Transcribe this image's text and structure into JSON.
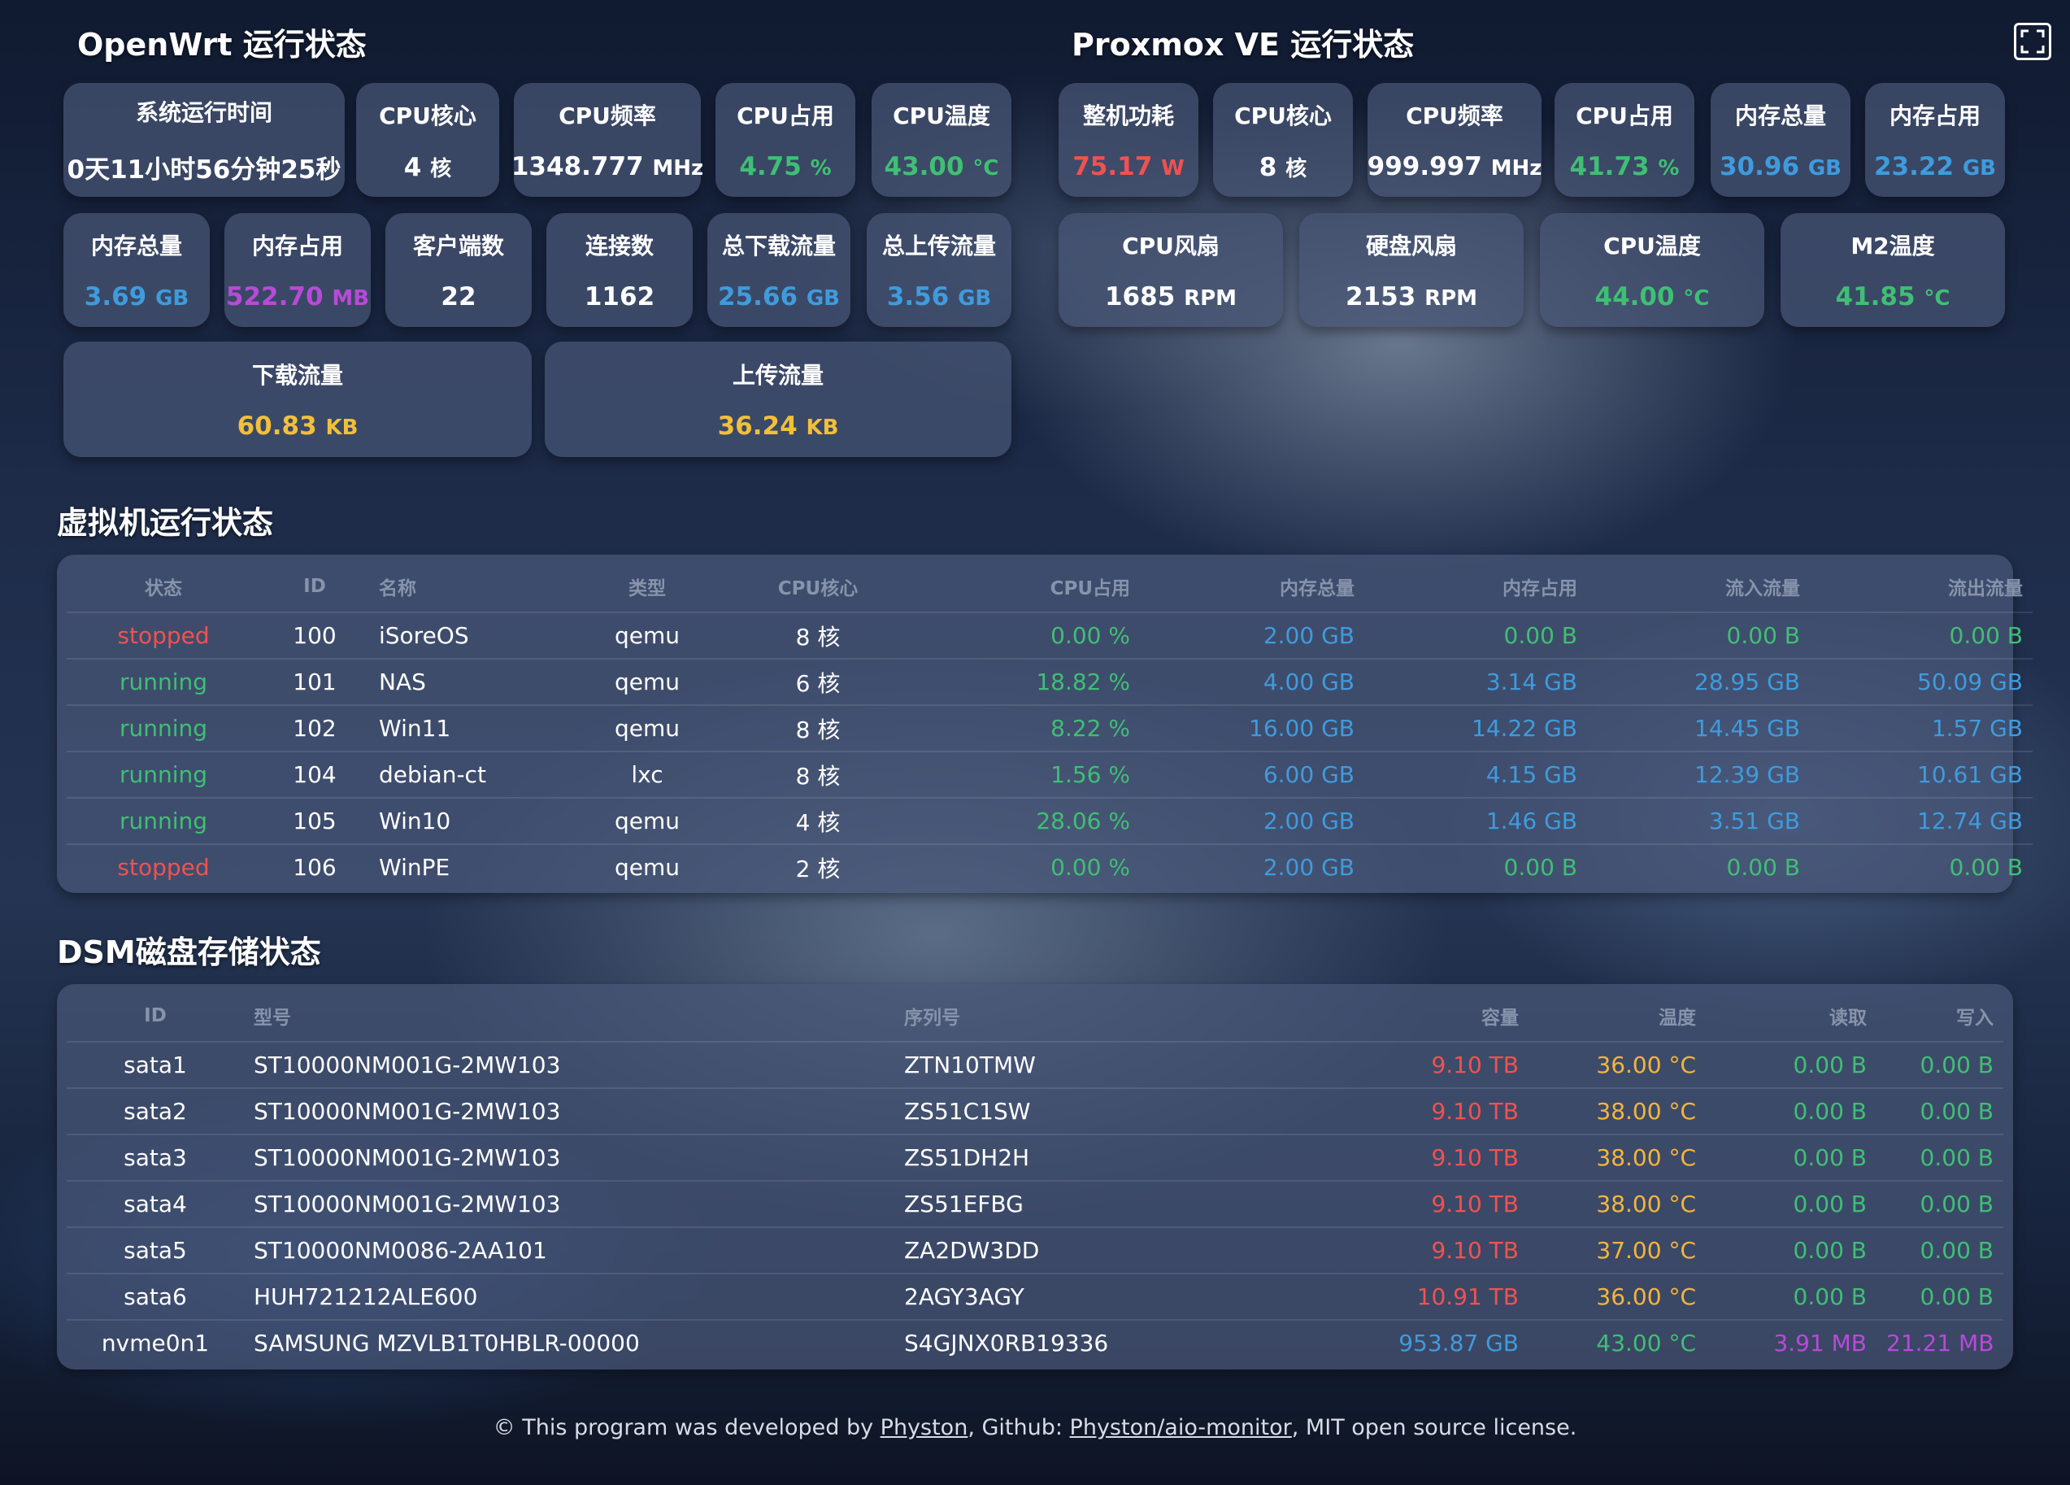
{
  "openwrt": {
    "title": "OpenWrt 运行状态",
    "uptime": {
      "label": "系统运行时间",
      "value": "0天11小时56分钟25秒"
    },
    "cpu_cores": {
      "label": "CPU核心",
      "value": "4",
      "unit": "核"
    },
    "cpu_freq": {
      "label": "CPU频率",
      "value": "1348.777",
      "unit": "MHz"
    },
    "cpu_usage": {
      "label": "CPU占用",
      "value": "4.75",
      "unit": "%"
    },
    "cpu_temp": {
      "label": "CPU温度",
      "value": "43.00",
      "unit": "°C"
    },
    "mem_total": {
      "label": "内存总量",
      "value": "3.69",
      "unit": "GB"
    },
    "mem_used": {
      "label": "内存占用",
      "value": "522.70",
      "unit": "MB"
    },
    "clients": {
      "label": "客户端数",
      "value": "22"
    },
    "connections": {
      "label": "连接数",
      "value": "1162"
    },
    "total_down": {
      "label": "总下载流量",
      "value": "25.66",
      "unit": "GB"
    },
    "total_up": {
      "label": "总上传流量",
      "value": "3.56",
      "unit": "GB"
    },
    "down_rate": {
      "label": "下载流量",
      "value": "60.83",
      "unit": "KB"
    },
    "up_rate": {
      "label": "上传流量",
      "value": "36.24",
      "unit": "KB"
    }
  },
  "pve": {
    "title": "Proxmox VE 运行状态",
    "power": {
      "label": "整机功耗",
      "value": "75.17",
      "unit": "W"
    },
    "cpu_cores": {
      "label": "CPU核心",
      "value": "8",
      "unit": "核"
    },
    "cpu_freq": {
      "label": "CPU频率",
      "value": "999.997",
      "unit": "MHz"
    },
    "cpu_usage": {
      "label": "CPU占用",
      "value": "41.73",
      "unit": "%"
    },
    "mem_total": {
      "label": "内存总量",
      "value": "30.96",
      "unit": "GB"
    },
    "mem_used": {
      "label": "内存占用",
      "value": "23.22",
      "unit": "GB"
    },
    "cpu_fan": {
      "label": "CPU风扇",
      "value": "1685",
      "unit": "RPM"
    },
    "disk_fan": {
      "label": "硬盘风扇",
      "value": "2153",
      "unit": "RPM"
    },
    "cpu_temp": {
      "label": "CPU温度",
      "value": "44.00",
      "unit": "°C"
    },
    "m2_temp": {
      "label": "M2温度",
      "value": "41.85",
      "unit": "°C"
    }
  },
  "vm": {
    "title": "虚拟机运行状态",
    "headers": [
      "状态",
      "ID",
      "名称",
      "类型",
      "CPU核心",
      "CPU占用",
      "内存总量",
      "内存占用",
      "流入流量",
      "流出流量"
    ],
    "rows": [
      [
        "stopped",
        "100",
        "iSoreOS",
        "qemu",
        "8 核",
        "0.00 %",
        "2.00 GB",
        "0.00 B",
        "0.00 B",
        "0.00 B"
      ],
      [
        "running",
        "101",
        "NAS",
        "qemu",
        "6 核",
        "18.82 %",
        "4.00 GB",
        "3.14 GB",
        "28.95 GB",
        "50.09 GB"
      ],
      [
        "running",
        "102",
        "Win11",
        "qemu",
        "8 核",
        "8.22 %",
        "16.00 GB",
        "14.22 GB",
        "14.45 GB",
        "1.57 GB"
      ],
      [
        "running",
        "104",
        "debian-ct",
        "lxc",
        "8 核",
        "1.56 %",
        "6.00 GB",
        "4.15 GB",
        "12.39 GB",
        "10.61 GB"
      ],
      [
        "running",
        "105",
        "Win10",
        "qemu",
        "4 核",
        "28.06 %",
        "2.00 GB",
        "1.46 GB",
        "3.51 GB",
        "12.74 GB"
      ],
      [
        "stopped",
        "106",
        "WinPE",
        "qemu",
        "2 核",
        "0.00 %",
        "2.00 GB",
        "0.00 B",
        "0.00 B",
        "0.00 B"
      ]
    ]
  },
  "dsm": {
    "title": "DSM磁盘存储状态",
    "headers": [
      "ID",
      "型号",
      "序列号",
      "容量",
      "温度",
      "读取",
      "写入"
    ],
    "rows": [
      [
        "sata1",
        "ST10000NM001G-2MW103",
        "ZTN10TMW",
        "9.10 TB",
        "36.00 °C",
        "0.00 B",
        "0.00 B"
      ],
      [
        "sata2",
        "ST10000NM001G-2MW103",
        "ZS51C1SW",
        "9.10 TB",
        "38.00 °C",
        "0.00 B",
        "0.00 B"
      ],
      [
        "sata3",
        "ST10000NM001G-2MW103",
        "ZS51DH2H",
        "9.10 TB",
        "38.00 °C",
        "0.00 B",
        "0.00 B"
      ],
      [
        "sata4",
        "ST10000NM001G-2MW103",
        "ZS51EFBG",
        "9.10 TB",
        "38.00 °C",
        "0.00 B",
        "0.00 B"
      ],
      [
        "sata5",
        "ST10000NM0086-2AA101",
        "ZA2DW3DD",
        "9.10 TB",
        "37.00 °C",
        "0.00 B",
        "0.00 B"
      ],
      [
        "sata6",
        "HUH721212ALE600",
        "2AGY3AGY",
        "10.91 TB",
        "36.00 °C",
        "0.00 B",
        "0.00 B"
      ],
      [
        "nvme0n1",
        "SAMSUNG MZVLB1T0HBLR-00000",
        "S4GJNX0RB19336",
        "953.87 GB",
        "43.00 °C",
        "3.91 MB",
        "21.21 MB"
      ]
    ]
  },
  "footer": {
    "prefix": "© This program was developed by ",
    "author": "Physton",
    "middle": ", Github: ",
    "repo": "Physton/aio-monitor",
    "suffix": ", MIT open source license."
  },
  "icons": {
    "fullscreen": "fullscreen-icon"
  },
  "colors": {
    "red": "#f0524f",
    "green": "#3fbf74",
    "blue": "#3f9bdc",
    "purple": "#b84ad8",
    "yellow": "#f2c038",
    "orange": "#f5b53a"
  }
}
